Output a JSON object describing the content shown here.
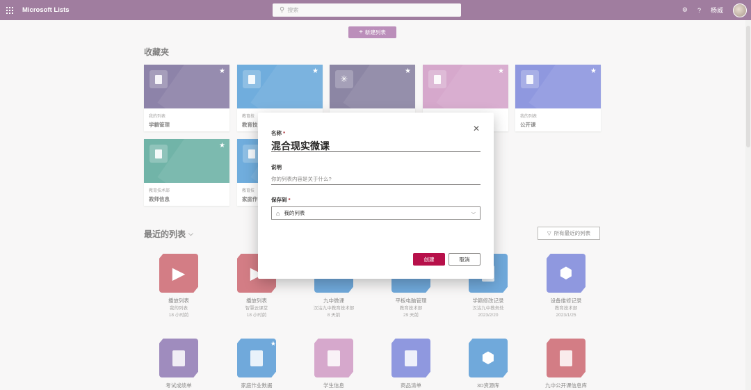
{
  "app": {
    "title": "Microsoft Lists"
  },
  "search": {
    "placeholder": "搜索"
  },
  "topbar": {
    "help": "?",
    "user_name": "杨威"
  },
  "toolbar": {
    "new_list_label": "新建列表"
  },
  "favorites": {
    "title": "收藏夹",
    "cards": [
      {
        "sub": "我的列表",
        "name": "学籍管理",
        "color": "#3b2a6b",
        "icon": "clipboard-icon"
      },
      {
        "sub": "教育技",
        "name": "教育技",
        "color": "#0a72c4",
        "icon": "clipboard-icon"
      },
      {
        "sub": "",
        "name": "",
        "color": "#3a2f63",
        "icon": "lightbulb-icon"
      },
      {
        "sub": "",
        "name": "",
        "color": "#b869a8",
        "icon": "clipboard-icon"
      },
      {
        "sub": "我的列表",
        "name": "公开课",
        "color": "#3f4fc9",
        "icon": "clipboard-icon"
      },
      {
        "sub": "教育技术部",
        "name": "教师信息",
        "color": "#0b7e6a",
        "icon": "clipboard-icon"
      },
      {
        "sub": "教育技",
        "name": "家庭作",
        "color": "#0a72c4",
        "icon": "clipboard-icon"
      }
    ]
  },
  "recent": {
    "title": "最近的列表",
    "all_recent_label": "所有最近的列表",
    "row1": [
      {
        "name": "播放列表",
        "sub1": "我的列表",
        "sub2": "18 小时前",
        "color": "#b3202d",
        "icon": "play-icon"
      },
      {
        "name": "播放列表",
        "sub1": "智慧云课堂",
        "sub2": "18 小时前",
        "color": "#b3202d",
        "icon": "play-icon"
      },
      {
        "name": "九中微课",
        "sub1": "汉沽九中教育技术部",
        "sub2": "8 天前",
        "color": "#0a6cc2",
        "icon": "people-icon"
      },
      {
        "name": "平板电脑管理",
        "sub1": "教育技术部",
        "sub2": "29 天前",
        "color": "#0a6cc2",
        "icon": "tablet-icon"
      },
      {
        "name": "学籍修改记录",
        "sub1": "汉沽九中教务处",
        "sub2": "2023/2/20",
        "color": "#0a6cc2",
        "icon": "document-icon"
      },
      {
        "name": "设备维修记录",
        "sub1": "教育技术部",
        "sub2": "2023/1/25",
        "color": "#3f4fc9",
        "icon": "cube-icon"
      }
    ],
    "row2": [
      {
        "name": "考试成绩单",
        "color": "#5b3a8f",
        "icon": "clipboard-icon"
      },
      {
        "name": "家庭作业数据",
        "color": "#0a6cc2",
        "icon": "clipboard-icon"
      },
      {
        "name": "学生信息",
        "color": "#b869a8",
        "icon": "clipboard-icon"
      },
      {
        "name": "商品清单",
        "color": "#3f4fc9",
        "icon": "clipboard-icon"
      },
      {
        "name": "3D资源库",
        "color": "#0a6cc2",
        "icon": "cube-icon"
      },
      {
        "name": "九中公开课信息库",
        "color": "#b3202d",
        "icon": "clipboard-icon"
      }
    ]
  },
  "dialog": {
    "name_label": "名称",
    "name_value": "混合现实微课",
    "desc_label": "说明",
    "desc_placeholder": "你的列表内容是关于什么?",
    "save_label": "保存到",
    "save_value": "我的列表",
    "required_mark": "*",
    "create_label": "创建",
    "cancel_label": "取消"
  }
}
